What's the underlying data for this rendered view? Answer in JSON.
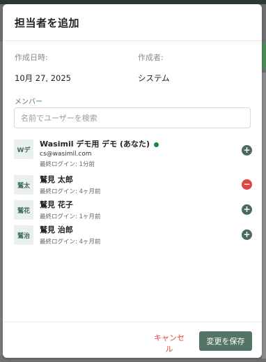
{
  "dialog": {
    "title": "担当者を追加",
    "created_at_label": "作成日時:",
    "created_at_value": "10月 27, 2025",
    "created_by_label": "作成者:",
    "created_by_value": "システム",
    "members_label": "メンバー",
    "search_placeholder": "名前でユーザーを検索"
  },
  "members": [
    {
      "avatar": "Wデ",
      "name": "Wasimil デモ用 デモ (あなた)",
      "email": "cs@wasimil.com",
      "last_login": "最終ログイン: 1分前",
      "online": true,
      "action": "add",
      "action_icon": "plus-icon"
    },
    {
      "avatar": "鷲太",
      "name": "鷲見 太郎",
      "last_login": "最終ログイン: 4ヶ月前",
      "action": "remove",
      "action_icon": "minus-icon"
    },
    {
      "avatar": "鷲花",
      "name": "鷲見 花子",
      "last_login": "最終ログイン: 1ヶ月前",
      "action": "add",
      "action_icon": "plus-icon"
    },
    {
      "avatar": "鷲治",
      "name": "鷲見 治郎",
      "last_login": "最終ログイン: 4ヶ月前",
      "action": "add",
      "action_icon": "plus-icon"
    }
  ],
  "footer": {
    "cancel_label": "キャンセル",
    "save_label": "変更を保存"
  },
  "colors": {
    "accent": "#547565",
    "danger": "#e04545",
    "online": "#1c8a3c"
  }
}
